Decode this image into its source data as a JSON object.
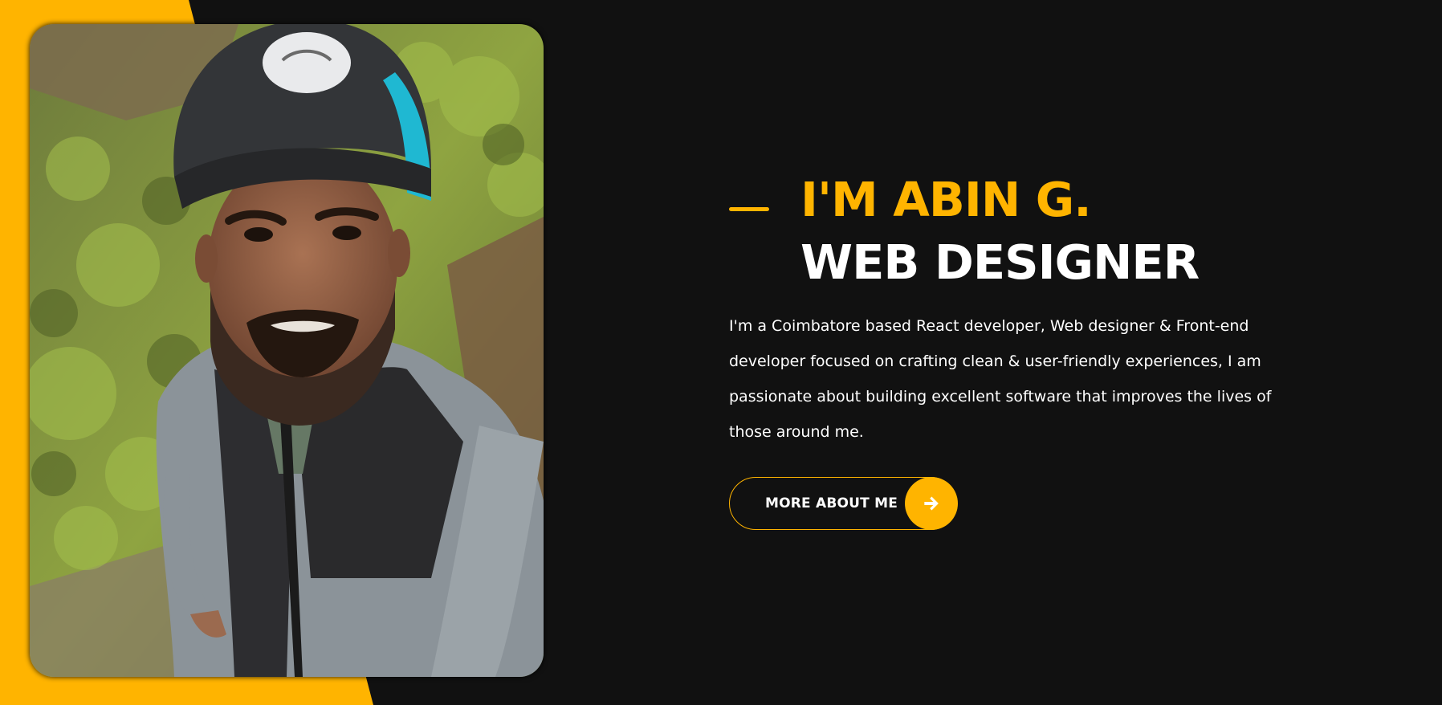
{
  "hero": {
    "greeting": "I'M ABIN G.",
    "role": "WEB DESIGNER",
    "bio": "I'm a Coimbatore based React developer, Web designer & Front-end developer focused on crafting clean & user-friendly experiences, I am passionate about building excellent software that improves the lives of those around me.",
    "cta_label": "MORE ABOUT ME",
    "cta_icon": "arrow-right-icon"
  },
  "colors": {
    "accent": "#ffb400",
    "background": "#111111",
    "text": "#ffffff"
  }
}
